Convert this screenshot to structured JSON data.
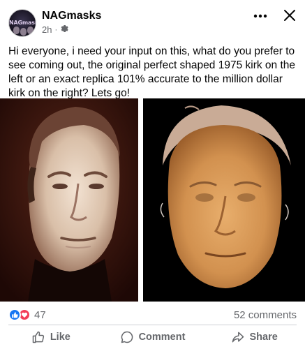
{
  "post": {
    "author": "NAGmasks",
    "avatar_text": "NAGmasks",
    "time": "2h",
    "separator": "·",
    "privacy_icon": "gear-icon",
    "text": "Hi everyone, i need your input on this, what do you prefer to see coming out, the original perfect shaped 1975 kirk on the left or an exact replica 101% accurate to the million dollar kirk on the right? Lets go!"
  },
  "header": {
    "more_icon": "more-options-icon",
    "close_icon": "close-icon"
  },
  "stats": {
    "reaction_icons": [
      "like-reaction-icon",
      "love-reaction-icon"
    ],
    "reactions_count": "47",
    "comments": "52 comments"
  },
  "actions": {
    "like": "Like",
    "comment": "Comment",
    "share": "Share"
  },
  "colors": {
    "like_blue": "#1877f2",
    "love_red": "#f33e58",
    "secondary_text": "#65676b"
  }
}
